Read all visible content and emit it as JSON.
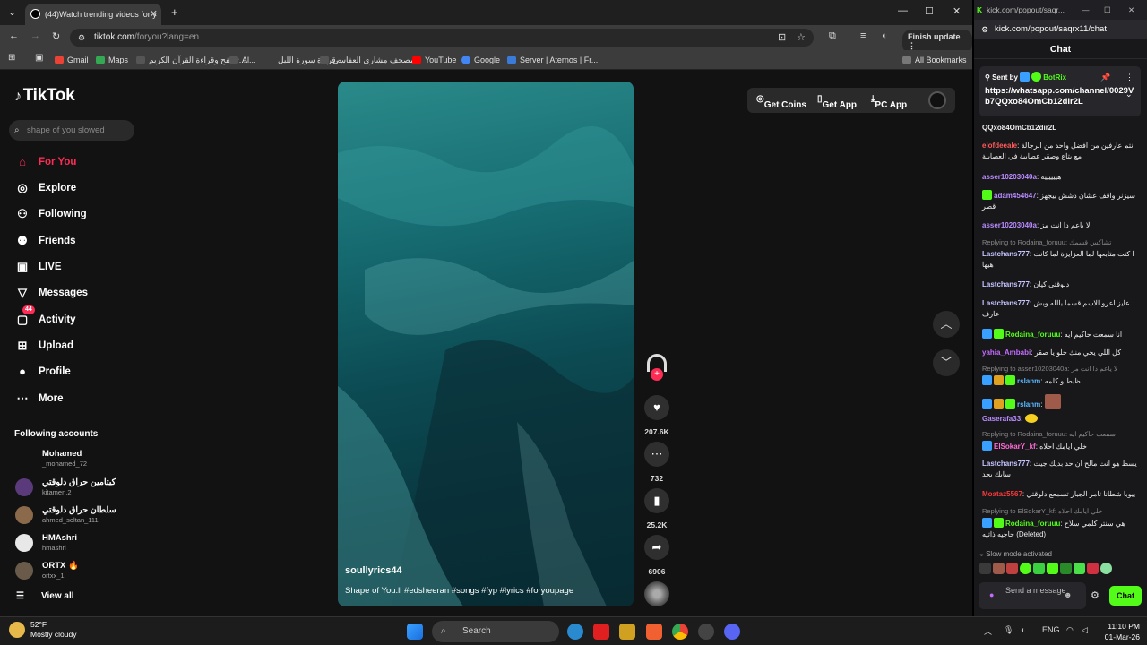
{
  "browser": {
    "tab_title": "(44)Watch trending videos for y",
    "url_main": "tiktok.com",
    "url_path": "/foryou?lang=en",
    "finish_update": "Finish update",
    "bookmarks": [
      "Gmail",
      "Maps",
      "تصفح وقراءة القرآن الكريم...",
      "Al...",
      "قراءة سورة الليل -",
      "مصحف مشاري العفاسي...",
      "YouTube",
      "Google",
      "Server | Aternos | Fr..."
    ],
    "all_bookmarks": "All Bookmarks"
  },
  "tiktok": {
    "logo": "TikTok",
    "search_placeholder": "shape of you slowed",
    "nav": [
      {
        "label": "For You",
        "icon": "home-icon"
      },
      {
        "label": "Explore",
        "icon": "compass-icon"
      },
      {
        "label": "Following",
        "icon": "following-icon"
      },
      {
        "label": "Friends",
        "icon": "friends-icon"
      },
      {
        "label": "LIVE",
        "icon": "live-icon"
      },
      {
        "label": "Messages",
        "icon": "messages-icon"
      },
      {
        "label": "Activity",
        "icon": "activity-icon"
      },
      {
        "label": "Upload",
        "icon": "upload-icon"
      },
      {
        "label": "Profile",
        "icon": "profile-icon"
      },
      {
        "label": "More",
        "icon": "more-icon"
      }
    ],
    "activity_badge": "44",
    "following_title": "Following accounts",
    "accounts": [
      {
        "name": "Mohamed",
        "handle": "_mohamed_72",
        "color": "#121212"
      },
      {
        "name": "كيتامين حراق دلوقتي",
        "handle": "kitamen.2",
        "color": "#5a3a7a"
      },
      {
        "name": "سلطان حراق دلوقتي",
        "handle": "ahmed_soltan_111",
        "color": "#8a6a4a"
      },
      {
        "name": "HMAshri",
        "handle": "hmashri",
        "color": "#e8e8e8"
      },
      {
        "name": "ORTX 🔥",
        "handle": "ortxx_1",
        "color": "#6a5a4a"
      }
    ],
    "view_all": "View all",
    "top_buttons": {
      "coins": "Get Coins",
      "app": "Get App",
      "pc": "PC App"
    },
    "video": {
      "username": "soullyrics44",
      "caption": "Shape of You.ll #edsheeran #songs #fyp #lyrics #foryoupage"
    },
    "actions": {
      "likes": "207.6K",
      "comments": "732",
      "saves": "25.2K",
      "shares": "6906"
    }
  },
  "kick": {
    "window_url": "kick.com/popout/saqr...",
    "url": "kick.com/popout/saqrx11/chat",
    "header": "Chat",
    "pinned_sent_by": "Sent by",
    "pinned_user": "BotRix",
    "pinned_link": "https://whatsapp.com/channel/0029Vb7QQxo84OmCb12dir2L",
    "partial_link": "QQxo84OmCb12dir2L",
    "messages": [
      {
        "user": "elofdeeale",
        "text": "انتم عارفين من افضل واحد من الرجالة مع بتاع وصقر عصابية في العصابية",
        "color": "#ff5a5a"
      },
      {
        "user": "asser10203040a",
        "text": "هييييييه",
        "color": "#b98cff"
      },
      {
        "user": "adam454647",
        "text": "سيزنر واقف عشان دشش بيجهز قصر",
        "color": "#b98cff"
      },
      {
        "user": "asser10203040a",
        "text": "لا ياعم دا انت مز",
        "color": "#b98cff"
      },
      {
        "reply": "Replying to Rodaina_foruuu: تشاكس قسمك"
      },
      {
        "user": "Lastchans777",
        "text": "ا كنت متابعها لما العزايزة لما كانت هيها",
        "color": "#c4c4ff"
      },
      {
        "user": "Lastchans777",
        "text": "دلوقتي كيان",
        "color": "#c4c4ff"
      },
      {
        "user": "Lastchans777",
        "text": "عايز اعرو الاسم قسما بالله وبش عارف",
        "color": "#c4c4ff"
      },
      {
        "user": "Rodaina_foruuu",
        "text": "انا سمعت حاكيم ايه",
        "color": "#53fc18"
      },
      {
        "user": "yahia_Ambabi",
        "text": "كل اللي يجي منك حلو يا صقر",
        "color": "#c46bff"
      },
      {
        "reply": "Replying to asser10203040a: لا ياعم دا انت مز"
      },
      {
        "user": "rslanm",
        "text": "ظبط و كلمه",
        "color": "#5ab8ff"
      },
      {
        "user": "rslanm",
        "text": "",
        "color": "#5ab8ff"
      },
      {
        "user": "Gaserafa33",
        "text": "",
        "color": "#b98cff"
      },
      {
        "reply": "Replying to Rodaina_foruuu: سمعت حاكيم ايه"
      },
      {
        "user": "ElSokarY_kf",
        "text": "خلي ايامك احلاه",
        "color": "#ff6bd5"
      },
      {
        "user": "Lastchans777",
        "text": "يسط هو انت مالح ان حد بديك جيت سابك بجد",
        "color": "#c4c4ff"
      },
      {
        "user": "Moataz5567",
        "text": "بيوبا شطانا تامر الجبار تسمعع دلوقتي",
        "color": "#ff3a3a"
      },
      {
        "reply": "Replying to ElSokarY_kf: خلي ايامك احلاه"
      },
      {
        "user": "Rodaina_foruuu",
        "text": "هي سنتر كلمي سلاح حاجيه ذاتيه (Deleted)",
        "color": "#53fc18"
      }
    ],
    "slow_mode": "Slow mode activated",
    "send_placeholder": "Send a message",
    "chat_button": "Chat"
  },
  "taskbar": {
    "temp": "52°F",
    "weather": "Mostly cloudy",
    "search": "Search",
    "lang": "ENG",
    "time": "11:10 PM",
    "date": "01-Mar-26"
  }
}
